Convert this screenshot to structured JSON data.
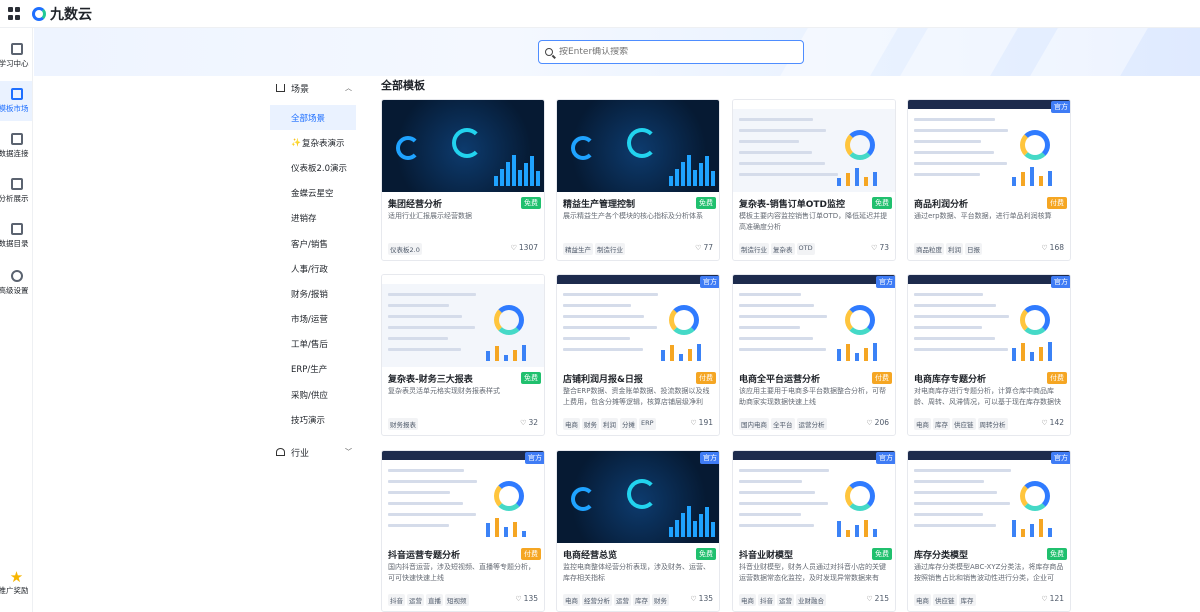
{
  "brand": {
    "name": "九数云"
  },
  "sidebar": {
    "items": [
      {
        "label": "学习中心",
        "icon": "book-icon"
      },
      {
        "label": "模板市场",
        "icon": "template-icon",
        "active": true
      },
      {
        "label": "数据连接",
        "icon": "database-icon"
      },
      {
        "label": "分析展示",
        "icon": "chart-icon"
      },
      {
        "label": "数据目录",
        "icon": "catalog-icon"
      },
      {
        "label": "高级设置",
        "icon": "settings-icon"
      }
    ],
    "bottom": {
      "label": "推广奖励",
      "icon": "star-icon"
    }
  },
  "search": {
    "placeholder": "按Enter确认搜索"
  },
  "categories": {
    "scene_title": "场景",
    "items": [
      {
        "label": "全部场景",
        "active": true
      },
      {
        "label": "复杂表演示",
        "spark": true
      },
      {
        "label": "仪表板2.0演示"
      },
      {
        "label": "金蝶云星空"
      },
      {
        "label": "进销存"
      },
      {
        "label": "客户/销售"
      },
      {
        "label": "人事/行政"
      },
      {
        "label": "财务/报销"
      },
      {
        "label": "市场/运营"
      },
      {
        "label": "工单/售后"
      },
      {
        "label": "ERP/生产"
      },
      {
        "label": "采购/供应"
      },
      {
        "label": "技巧演示"
      }
    ],
    "industry_title": "行业"
  },
  "main": {
    "title": "全部模板"
  },
  "official_label": "官方",
  "templates": [
    {
      "title": "集团经营分析",
      "tag": "免费",
      "paid": false,
      "official": false,
      "desc": "适用行业汇报展示经营数据",
      "tags": [
        "仪表板2.0"
      ],
      "likes": "1307",
      "style": "dark"
    },
    {
      "title": "精益生产管理控制",
      "tag": "免费",
      "paid": false,
      "official": false,
      "desc": "展示精益生产各个模块的核心指标及分析体系",
      "tags": [
        "精益生产",
        "制造行业"
      ],
      "likes": "77",
      "style": "dark"
    },
    {
      "title": "复杂表-销售订单OTD监控",
      "tag": "免费",
      "paid": false,
      "official": false,
      "desc": "模板主要内容监控销售订单OTD，降低延迟并提高准确度分析",
      "tags": [
        "制造行业",
        "复杂表",
        "OTD"
      ],
      "likes": "73",
      "style": "light"
    },
    {
      "title": "商品利润分析",
      "tag": "付费",
      "paid": true,
      "official": true,
      "desc": "通过erp数据、平台数据，进行单品利润核算",
      "tags": [
        "商品粒度",
        "利润",
        "日报"
      ],
      "likes": "168",
      "style": "navy"
    },
    {
      "title": "复杂表-财务三大报表",
      "tag": "免费",
      "paid": false,
      "official": false,
      "desc": "复杂表灵活单元格实现财务报表样式",
      "tags": [
        "财务报表"
      ],
      "likes": "32",
      "style": "light"
    },
    {
      "title": "店铺利润月报&日报",
      "tag": "付费",
      "paid": true,
      "official": true,
      "desc": "整合ERP数据、资金账单数据、投流数据以及线上费用，包含分摊等逻辑，核算店铺层级净利",
      "tags": [
        "电商",
        "财务",
        "利润",
        "分摊",
        "ERP"
      ],
      "likes": "191",
      "style": "navy"
    },
    {
      "title": "电商全平台运营分析",
      "tag": "付费",
      "paid": true,
      "official": true,
      "desc": "该应用主要用于电商多平台数据整合分析，可帮助商家实现数据快速上线",
      "tags": [
        "国内电商",
        "全平台",
        "运营分析"
      ],
      "likes": "206",
      "style": "navy"
    },
    {
      "title": "电商库存专题分析",
      "tag": "付费",
      "paid": true,
      "official": true,
      "desc": "对电商库存进行专题分析，计算仓库中商品库龄、周转、风滞情况，可以基于现在库存数据快",
      "tags": [
        "电商",
        "库存",
        "供应链",
        "周转分析"
      ],
      "likes": "142",
      "style": "navy"
    },
    {
      "title": "抖音运营专题分析",
      "tag": "付费",
      "paid": true,
      "official": true,
      "desc": "国内抖音运营，涉及短视频、直播等专题分析，可可快速快速上线",
      "tags": [
        "抖音",
        "运营",
        "直播",
        "短视频"
      ],
      "likes": "135",
      "style": "navy"
    },
    {
      "title": "电商经营总览",
      "tag": "免费",
      "paid": false,
      "official": true,
      "desc": "监控电商整体经营分析表现，涉及财务、运营、库存相关指标",
      "tags": [
        "电商",
        "经营分析",
        "运营",
        "库存",
        "财务"
      ],
      "likes": "135",
      "style": "dark"
    },
    {
      "title": "抖音业财模型",
      "tag": "免费",
      "paid": false,
      "official": true,
      "desc": "抖音业财模型，财务人员通过对抖音小店的关键运营数据常态化监控，及时发现异常数据来有",
      "tags": [
        "电商",
        "抖音",
        "运营",
        "业财融合"
      ],
      "likes": "215",
      "style": "navy"
    },
    {
      "title": "库存分类模型",
      "tag": "免费",
      "paid": false,
      "official": true,
      "desc": "通过库存分类模型ABC-XYZ分类法，将库存商品按照销售占比和销售波动性进行分类，企业可",
      "tags": [
        "电商",
        "供应链",
        "库存"
      ],
      "likes": "121",
      "style": "navy"
    }
  ]
}
